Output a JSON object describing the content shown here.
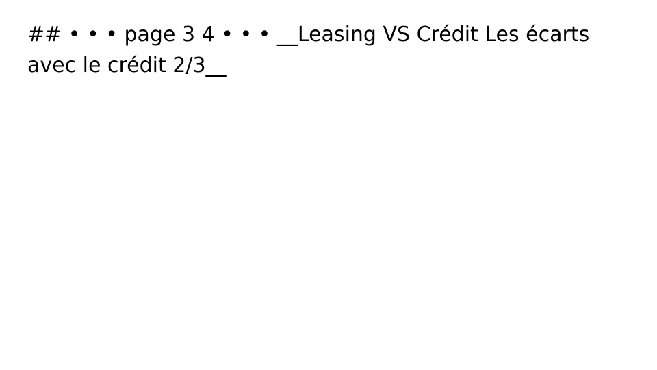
{
  "document": {
    "text": "## • • • page 3 4 • • • __Leasing VS Crédit Les écarts avec le crédit 2/3__"
  }
}
